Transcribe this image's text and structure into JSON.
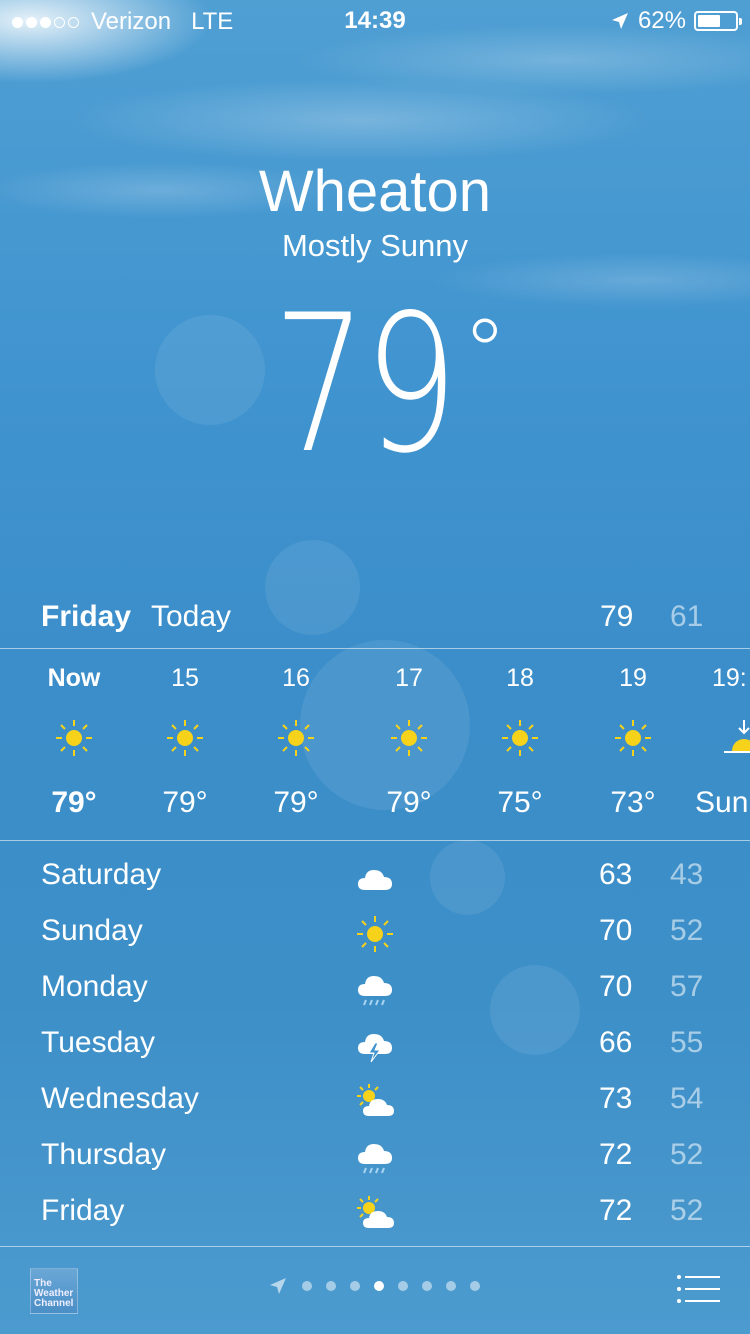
{
  "status_bar": {
    "carrier": "Verizon",
    "network": "LTE",
    "time": "14:39",
    "battery_percent": "62%",
    "battery_level": 0.62,
    "signal_bars_filled": 3,
    "signal_bars_total": 5
  },
  "header": {
    "city": "Wheaton",
    "condition": "Mostly Sunny",
    "temperature": "79",
    "degree_symbol": "°"
  },
  "today": {
    "day": "Friday",
    "label": "Today",
    "high": "79",
    "low": "61"
  },
  "hourly": [
    {
      "hour": "Now",
      "icon": "sun-icon",
      "temp": "79°"
    },
    {
      "hour": "15",
      "icon": "sun-icon",
      "temp": "79°"
    },
    {
      "hour": "16",
      "icon": "sun-icon",
      "temp": "79°"
    },
    {
      "hour": "17",
      "icon": "sun-icon",
      "temp": "79°"
    },
    {
      "hour": "18",
      "icon": "sun-icon",
      "temp": "75°"
    },
    {
      "hour": "19",
      "icon": "sun-icon",
      "temp": "73°"
    },
    {
      "hour": "19:",
      "icon": "sunset-icon",
      "temp": "Sun"
    }
  ],
  "daily": [
    {
      "day": "Saturday",
      "icon": "cloud-icon",
      "high": "63",
      "low": "43"
    },
    {
      "day": "Sunday",
      "icon": "sun-icon",
      "high": "70",
      "low": "52"
    },
    {
      "day": "Monday",
      "icon": "rain-icon",
      "high": "70",
      "low": "57"
    },
    {
      "day": "Tuesday",
      "icon": "thunderstorm-icon",
      "high": "66",
      "low": "55"
    },
    {
      "day": "Wednesday",
      "icon": "partly-cloudy-icon",
      "high": "73",
      "low": "54"
    },
    {
      "day": "Thursday",
      "icon": "rain-icon",
      "high": "72",
      "low": "52"
    },
    {
      "day": "Friday",
      "icon": "partly-cloudy-icon",
      "high": "72",
      "low": "52"
    }
  ],
  "bottom_bar": {
    "logo_text": "The Weather Channel",
    "page_count": 8,
    "active_page": 4
  },
  "colors": {
    "sun": "#f6d21b",
    "sky": "#3f93cf"
  }
}
